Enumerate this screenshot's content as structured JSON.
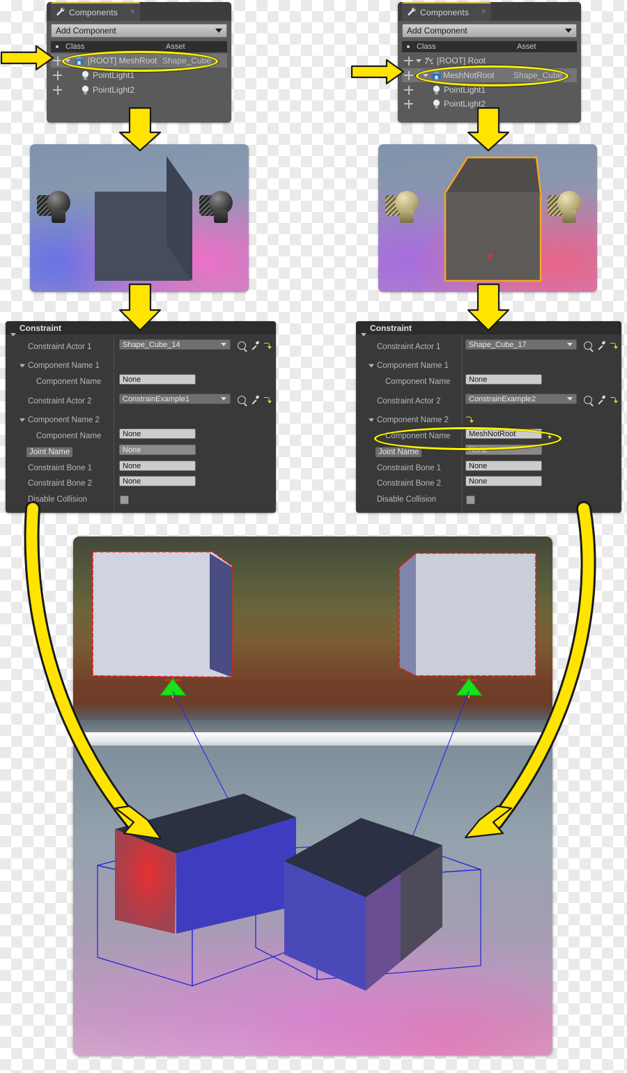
{
  "panels": {
    "components_left": {
      "tab_title": "Components",
      "tab_icon": "wrench-icon",
      "close_label": "×",
      "add_button": "Add Component",
      "columns": {
        "class": "Class",
        "asset": "Asset"
      },
      "rows": [
        {
          "label": "[ROOT] MeshRoot",
          "asset": "Shape_Cube",
          "icon": "mesh-icon",
          "highlighted": true
        },
        {
          "label": "PointLight1",
          "asset": "",
          "icon": "bulb-icon",
          "highlighted": false
        },
        {
          "label": "PointLight2",
          "asset": "",
          "icon": "bulb-icon",
          "highlighted": false
        }
      ]
    },
    "components_right": {
      "tab_title": "Components",
      "tab_icon": "wrench-icon",
      "close_label": "×",
      "add_button": "Add Component",
      "columns": {
        "class": "Class",
        "asset": "Asset"
      },
      "rows": [
        {
          "label": "[ROOT] Root",
          "asset": "",
          "icon": "scene-root-icon",
          "highlighted": false
        },
        {
          "label": "MeshNotRoot",
          "asset": "Shape_Cube",
          "icon": "mesh-icon",
          "highlighted": true
        },
        {
          "label": "PointLight1",
          "asset": "",
          "icon": "bulb-icon",
          "highlighted": false
        },
        {
          "label": "PointLight2",
          "asset": "",
          "icon": "bulb-icon",
          "highlighted": false
        }
      ]
    },
    "constraint_left": {
      "title": "Constraint",
      "rows": [
        {
          "label": "Constraint Actor 1",
          "value": "Shape_Cube_14",
          "type": "combo",
          "indent": 0
        },
        {
          "label": "Component Name 1",
          "value": "",
          "type": "group",
          "indent": 0
        },
        {
          "label": "Component Name",
          "value": "None",
          "type": "text",
          "indent": 1
        },
        {
          "label": "Constraint Actor 2",
          "value": "ConstrainExample1",
          "type": "combo",
          "indent": 0
        },
        {
          "label": "Component Name 2",
          "value": "",
          "type": "group",
          "indent": 0
        },
        {
          "label": "Component Name",
          "value": "None",
          "type": "text",
          "indent": 1
        },
        {
          "label": "Joint Name",
          "value": "None",
          "type": "text-dim",
          "indent": 0,
          "label_selected": true
        },
        {
          "label": "Constraint Bone 1",
          "value": "None",
          "type": "text",
          "indent": 0
        },
        {
          "label": "Constraint Bone 2",
          "value": "None",
          "type": "text",
          "indent": 0
        },
        {
          "label": "Disable Collision",
          "value": "",
          "type": "checkbox",
          "indent": 0
        }
      ]
    },
    "constraint_right": {
      "title": "Constraint",
      "rows": [
        {
          "label": "Constraint Actor 1",
          "value": "Shape_Cube_17",
          "type": "combo",
          "indent": 0
        },
        {
          "label": "Component Name 1",
          "value": "",
          "type": "group",
          "indent": 0
        },
        {
          "label": "Component Name",
          "value": "None",
          "type": "text",
          "indent": 1
        },
        {
          "label": "Constraint Actor 2",
          "value": "ConstrainExample2",
          "type": "combo",
          "indent": 0
        },
        {
          "label": "Component Name 2",
          "value": "",
          "type": "group",
          "indent": 0
        },
        {
          "label": "Component Name",
          "value": "MeshNotRoot",
          "type": "text",
          "indent": 1,
          "highlighted": true
        },
        {
          "label": "Joint Name",
          "value": "None",
          "type": "text-dim",
          "indent": 0,
          "label_selected": true
        },
        {
          "label": "Constraint Bone 1",
          "value": "None",
          "type": "text",
          "indent": 0
        },
        {
          "label": "Constraint Bone 2",
          "value": "None",
          "type": "text",
          "indent": 0
        },
        {
          "label": "Disable Collision",
          "value": "",
          "type": "checkbox",
          "indent": 0
        }
      ]
    }
  },
  "viewports": {
    "thumb_left": {
      "name": "blueprint-preview-meshroot",
      "cube_selected": false,
      "light_color": "#3a3a3a"
    },
    "thumb_right": {
      "name": "blueprint-preview-meshnotroot",
      "cube_selected": true,
      "selection_color": "#f5a623",
      "light_color": "#b6a871"
    },
    "big": {
      "name": "level-viewport"
    }
  },
  "colors": {
    "highlight_yellow": "#fff200",
    "arrow_yellow": "#ffe400",
    "panel_bg": "#5a5a5a",
    "constraint_bg": "#393939",
    "selection_orange": "#f5a623",
    "wireframe_blue": "#1f1fd8",
    "wireframe_red": "#e81010"
  }
}
